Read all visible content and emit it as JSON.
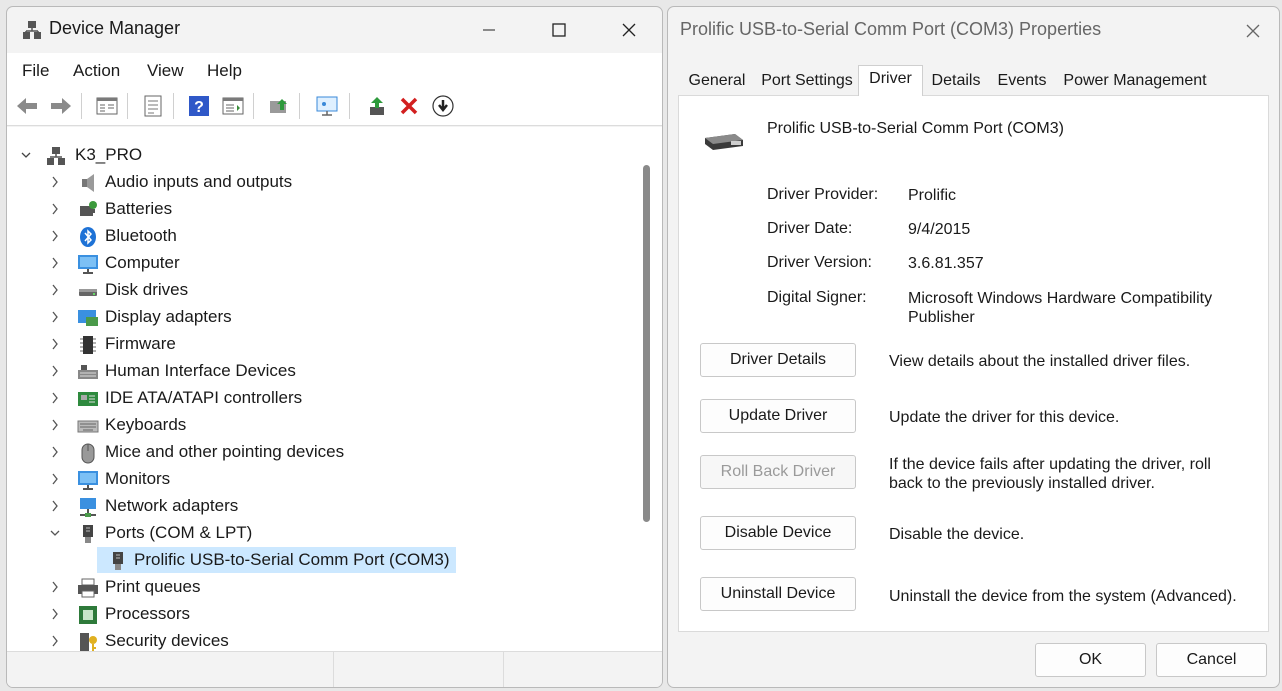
{
  "device_manager": {
    "title": "Device Manager",
    "menu": [
      "File",
      "Action",
      "View",
      "Help"
    ],
    "root": "K3_PRO",
    "categories": [
      {
        "label": "Audio inputs and outputs",
        "icon": "speaker-icon"
      },
      {
        "label": "Batteries",
        "icon": "battery-icon"
      },
      {
        "label": "Bluetooth",
        "icon": "bluetooth-icon"
      },
      {
        "label": "Computer",
        "icon": "monitor-icon"
      },
      {
        "label": "Disk drives",
        "icon": "disk-drive-icon"
      },
      {
        "label": "Display adapters",
        "icon": "display-adapter-icon"
      },
      {
        "label": "Firmware",
        "icon": "chip-icon"
      },
      {
        "label": "Human Interface Devices",
        "icon": "hid-icon"
      },
      {
        "label": "IDE ATA/ATAPI controllers",
        "icon": "ide-controller-icon"
      },
      {
        "label": "Keyboards",
        "icon": "keyboard-icon"
      },
      {
        "label": "Mice and other pointing devices",
        "icon": "mouse-icon"
      },
      {
        "label": "Monitors",
        "icon": "monitor-icon"
      },
      {
        "label": "Network adapters",
        "icon": "network-icon"
      },
      {
        "label": "Ports (COM & LPT)",
        "icon": "port-icon"
      },
      {
        "label": "Prolific USB-to-Serial Comm Port (COM3)",
        "icon": "port-icon"
      },
      {
        "label": "Print queues",
        "icon": "printer-icon"
      },
      {
        "label": "Processors",
        "icon": "processor-icon"
      },
      {
        "label": "Security devices",
        "icon": "security-icon"
      }
    ]
  },
  "properties": {
    "title": "Prolific USB-to-Serial Comm Port (COM3) Properties",
    "tabs": [
      "General",
      "Port Settings",
      "Driver",
      "Details",
      "Events",
      "Power Management"
    ],
    "active_tab": "Driver",
    "device_name": "Prolific USB-to-Serial Comm Port (COM3)",
    "fields": [
      {
        "label": "Driver Provider:",
        "value": "Prolific"
      },
      {
        "label": "Driver Date:",
        "value": "9/4/2015"
      },
      {
        "label": "Driver Version:",
        "value": "3.6.81.357"
      },
      {
        "label": "Digital Signer:",
        "value": "Microsoft Windows Hardware Compatibility Publisher"
      }
    ],
    "actions": [
      {
        "label": "Driver Details",
        "desc": "View details about the installed driver files.",
        "enabled": true
      },
      {
        "label": "Update Driver",
        "desc": "Update the driver for this device.",
        "enabled": true
      },
      {
        "label": "Roll Back Driver",
        "desc": "If the device fails after updating the driver, roll back to the previously installed driver.",
        "enabled": false
      },
      {
        "label": "Disable Device",
        "desc": "Disable the device.",
        "enabled": true
      },
      {
        "label": "Uninstall Device",
        "desc": "Uninstall the device from the system (Advanced).",
        "enabled": true
      }
    ],
    "ok": "OK",
    "cancel": "Cancel"
  }
}
